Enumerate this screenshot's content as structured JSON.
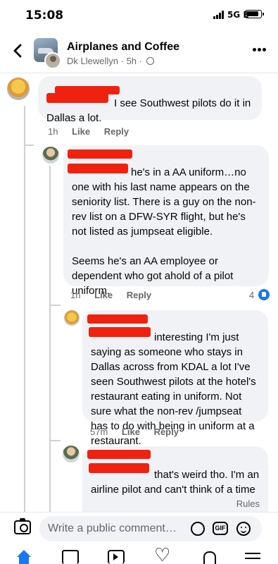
{
  "status": {
    "time": "15:08",
    "network": "5G E"
  },
  "header": {
    "group_name": "Airplanes and Coffee",
    "post_meta": "Dk Llewellyn · 5h ·"
  },
  "comments": [
    {
      "text": "I see Southwest pilots do it in Dallas a lot.",
      "time": "1h",
      "like": "Like",
      "reply": "Reply"
    },
    {
      "text": "he's in a AA uniform…no one with his last name appears on the seniority list.  There is a guy on the non-rev list on a DFW-SYR flight, but he's not listed as jumpseat eligible.",
      "text2": "Seems he's an AA employee or dependent who got ahold of a pilot uniform.",
      "time": "1h",
      "like": "Like",
      "reply": "Reply",
      "reaction_count": "4"
    },
    {
      "text": "interesting I'm just saying as someone who stays in Dallas across from KDAL a lot I've seen Southwest pilots at the hotel's restaurant eating in uniform. Not sure what the non-rev /jumpseat has to do with being in uniform at a restaurant.",
      "time": "57m",
      "like": "Like",
      "reply": "Reply"
    },
    {
      "text": "that's weird tho.  I'm an airline pilot and can't think of a time"
    }
  ],
  "rules": "Rules",
  "composer": {
    "placeholder": "Write a public comment…",
    "gif": "GIF"
  },
  "colors": {
    "accent": "#1877f2",
    "redaction": "#f0220f",
    "bubble": "#f0f2f5"
  }
}
